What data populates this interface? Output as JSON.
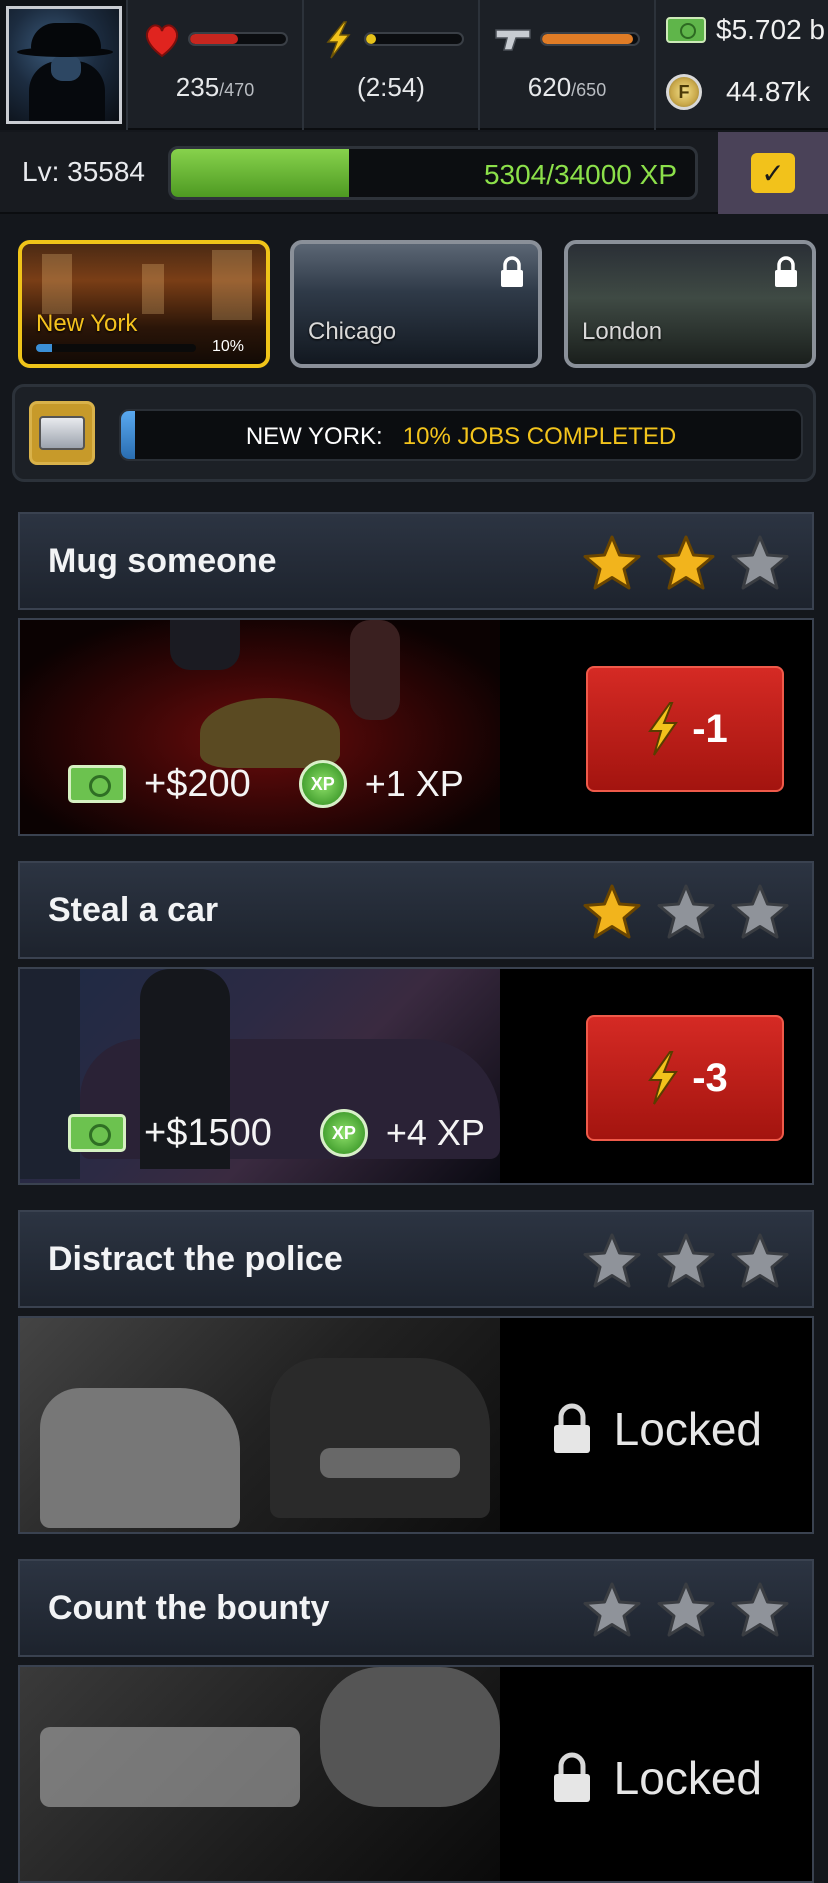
{
  "stats": {
    "health": {
      "current": "235",
      "max": "/470",
      "fill": 0.5
    },
    "energy": {
      "timer": "(2:54)",
      "fill": 0.1
    },
    "ammo": {
      "current": "620",
      "max": "/650",
      "fill": 0.95
    },
    "cash": "$5.702 b",
    "coins": "44.87k"
  },
  "level": {
    "label": "Lv: 35584",
    "xp_text": "5304/34000 XP",
    "xp_fill": 0.34
  },
  "cities": [
    {
      "name": "New York",
      "percent": "10%",
      "locked": false,
      "progress": 0.1
    },
    {
      "name": "Chicago",
      "locked": true
    },
    {
      "name": "London",
      "locked": true
    }
  ],
  "jobs_progress": {
    "city_label": "NEW YORK:",
    "status": "10% JOBS COMPLETED",
    "fill": 0.02
  },
  "jobs": [
    {
      "title": "Mug someone",
      "stars": 2,
      "cash": "+$200",
      "xp": "+1 XP",
      "energy_cost": "-1",
      "locked": false
    },
    {
      "title": "Steal a car",
      "stars": 1,
      "cash": "+$1500",
      "xp": "+4 XP",
      "energy_cost": "-3",
      "locked": false
    },
    {
      "title": "Distract the police",
      "stars": 0,
      "locked": true,
      "locked_label": "Locked"
    },
    {
      "title": "Count the bounty",
      "stars": 0,
      "locked": true,
      "locked_label": "Locked"
    }
  ],
  "icons": {
    "xp_coin": "XP",
    "coin": "F"
  },
  "colors": {
    "accent_yellow": "#f0c419",
    "xp_green": "#8ce04a",
    "energy_red": "#c41e18",
    "star_gold": "#f2b41c",
    "star_gray": "#8f939a"
  }
}
